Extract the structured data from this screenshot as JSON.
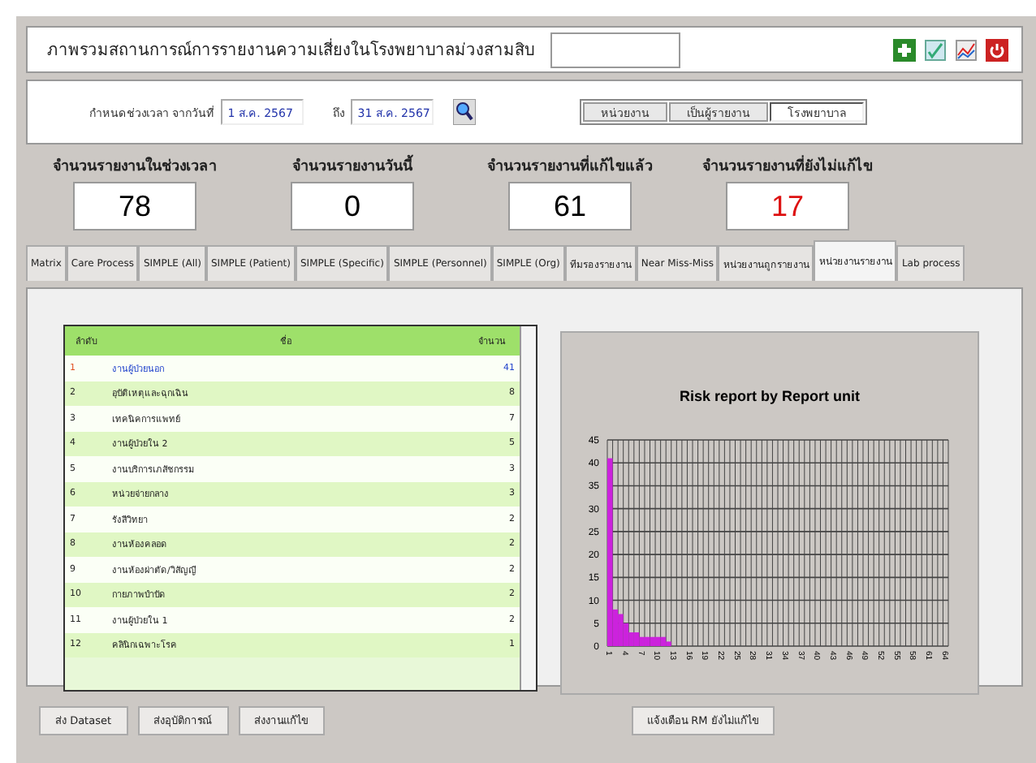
{
  "window": {
    "title": "ภาพรวมสถานการณ์การรายงานความเสี่ยงในโรงพยาบาลม่วงสามสิบ"
  },
  "filter": {
    "from_label": "กำหนดช่วงเวลา จากวันที่",
    "from": "1 ส.ค. 2567",
    "to_label": "ถึง",
    "to": "31 ส.ค. 2567"
  },
  "scope": [
    {
      "label": "หน่วยงาน",
      "selected": false
    },
    {
      "label": "เป็นผู้รายงาน",
      "selected": false
    },
    {
      "label": "โรงพยาบาล",
      "selected": true
    }
  ],
  "stats": [
    {
      "label": "จำนวนรายงานในช่วงเวลา",
      "value": "78",
      "color": "#000000"
    },
    {
      "label": "จำนวนรายงานวันนี้",
      "value": "0",
      "color": "#000000"
    },
    {
      "label": "จำนวนรายงานที่แก้ไขแล้ว",
      "value": "61",
      "color": "#000000"
    },
    {
      "label": "จำนวนรายงานที่ยังไม่แก้ไข",
      "value": "17",
      "color": "#dd1111"
    }
  ],
  "tabs": [
    {
      "label": "Matrix",
      "selected": false
    },
    {
      "label": "Care Process",
      "selected": false
    },
    {
      "label": "SIMPLE (All)",
      "selected": false
    },
    {
      "label": "SIMPLE (Patient)",
      "selected": false
    },
    {
      "label": "SIMPLE (Specific)",
      "selected": false
    },
    {
      "label": "SIMPLE (Personnel)",
      "selected": false
    },
    {
      "label": "SIMPLE (Org)",
      "selected": false
    },
    {
      "label": "ทีมรองรายงาน",
      "selected": false
    },
    {
      "label": "Near Miss-Miss",
      "selected": false
    },
    {
      "label": "หน่วยงานถูกรายงาน",
      "selected": false
    },
    {
      "label": "หน่วยงานรายงาน",
      "selected": true
    },
    {
      "label": "Lab process",
      "selected": false
    }
  ],
  "table": {
    "columns": [
      "ลำดับ",
      "ชื่อ",
      "จำนวน"
    ],
    "rows": [
      {
        "cells": [
          "1",
          "งานผู้ป่วยนอก",
          "41"
        ],
        "selected": true
      },
      {
        "cells": [
          "2",
          "อุบัติเหตุและฉุกเฉิน",
          "8"
        ],
        "selected": false
      },
      {
        "cells": [
          "3",
          "เทคนิคการแพทย์",
          "7"
        ],
        "selected": false
      },
      {
        "cells": [
          "4",
          "งานผู้ป่วยใน 2",
          "5"
        ],
        "selected": false
      },
      {
        "cells": [
          "5",
          "งานบริการเภสัชกรรม",
          "3"
        ],
        "selected": false
      },
      {
        "cells": [
          "6",
          "หน่วยจ่ายกลาง",
          "3"
        ],
        "selected": false
      },
      {
        "cells": [
          "7",
          "รังสีวิทยา",
          "2"
        ],
        "selected": false
      },
      {
        "cells": [
          "8",
          "งานห้องคลอด",
          "2"
        ],
        "selected": false
      },
      {
        "cells": [
          "9",
          "งานห้องผ่าตัด/วิสัญญี",
          "2"
        ],
        "selected": false
      },
      {
        "cells": [
          "10",
          "กายภาพบำบัด",
          "2"
        ],
        "selected": false
      },
      {
        "cells": [
          "11",
          "งานผู้ป่วยใน 1",
          "2"
        ],
        "selected": false
      },
      {
        "cells": [
          "12",
          "คลินิกเฉพาะโรค",
          "1"
        ],
        "selected": false
      }
    ]
  },
  "chart": {
    "chart_data": {
      "type": "bar",
      "title": "Risk report by Report unit",
      "x": [
        1,
        2,
        3,
        4,
        5,
        6,
        7,
        8,
        9,
        10,
        11,
        12
      ],
      "series": [
        {
          "color": "#cc22dd",
          "values": [
            41,
            8,
            7,
            5,
            3,
            3,
            2,
            2,
            2,
            2,
            2,
            1
          ]
        }
      ],
      "xlim": [
        1,
        64
      ],
      "ylim": [
        0,
        45
      ],
      "yticks": [
        0,
        5,
        10,
        15,
        20,
        25,
        30,
        35,
        40,
        45
      ],
      "grid": true,
      "xticks": [
        1,
        4,
        7,
        10,
        13,
        16,
        19,
        22,
        25,
        28,
        31,
        34,
        37,
        40,
        43,
        46,
        49,
        52,
        55,
        58,
        61,
        64
      ]
    }
  },
  "buttons": [
    "ส่ง Dataset",
    "ส่งอุบัติการณ์",
    "ส่งงานแก้ไข"
  ],
  "alert_button": "แจ้งเตือน RM ยังไม่แก้ไข"
}
